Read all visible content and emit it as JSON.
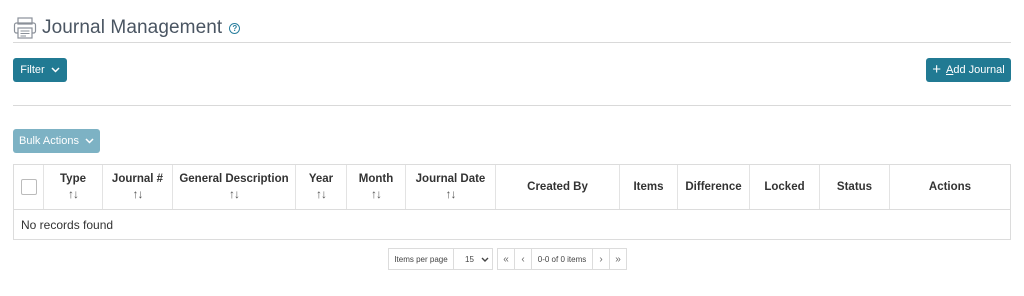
{
  "header": {
    "icon": "printer-icon",
    "title": "Journal Management",
    "help_icon": "help-circle-icon"
  },
  "toolbar": {
    "filter_label": "Filter",
    "add_label_prefix": "",
    "add_label_underlined": "A",
    "add_label_rest": "dd Journal"
  },
  "bulk": {
    "label": "Bulk Actions"
  },
  "grid": {
    "columns": [
      {
        "label": "Type",
        "sortable": true
      },
      {
        "label": "Journal #",
        "sortable": true
      },
      {
        "label": "General Description",
        "sortable": true
      },
      {
        "label": "Year",
        "sortable": true
      },
      {
        "label": "Month",
        "sortable": true
      },
      {
        "label": "Journal Date",
        "sortable": true
      },
      {
        "label": "Created By",
        "sortable": false
      },
      {
        "label": "Items",
        "sortable": false
      },
      {
        "label": "Difference",
        "sortable": false
      },
      {
        "label": "Locked",
        "sortable": false
      },
      {
        "label": "Status",
        "sortable": false
      },
      {
        "label": "Actions",
        "sortable": false
      }
    ],
    "sort_glyph": "↑↓",
    "empty_message": "No records found"
  },
  "pager": {
    "items_per_page_label": "Items per page",
    "page_size": "15",
    "first": "«",
    "prev": "‹",
    "info": "0-0 of 0 items",
    "next": "›",
    "last": "»"
  },
  "colors": {
    "primary": "#217a93",
    "primary_disabled": "#7db2c4",
    "title": "#4a5562"
  }
}
